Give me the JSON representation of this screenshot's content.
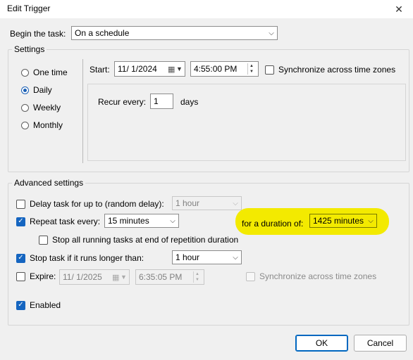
{
  "window": {
    "title": "Edit Trigger",
    "close_glyph": "✕"
  },
  "begin": {
    "label": "Begin the task:",
    "value": "On a schedule"
  },
  "settings": {
    "legend": "Settings",
    "radios": [
      {
        "label": "One time",
        "selected": false
      },
      {
        "label": "Daily",
        "selected": true
      },
      {
        "label": "Weekly",
        "selected": false
      },
      {
        "label": "Monthly",
        "selected": false
      }
    ],
    "start_label": "Start:",
    "start_date": "11/  1/2024",
    "start_time": "4:55:00 PM",
    "sync_label": "Synchronize across time zones",
    "recur_label": "Recur every:",
    "recur_value": "1",
    "recur_unit": "days"
  },
  "advanced": {
    "legend": "Advanced settings",
    "delay": {
      "label": "Delay task for up to (random delay):",
      "value": "1 hour",
      "checked": false
    },
    "repeat": {
      "label": "Repeat task every:",
      "value": "15 minutes",
      "checked": true
    },
    "duration": {
      "label": "for a duration of:",
      "value": "1425 minutes"
    },
    "stop_running": {
      "label": "Stop all running tasks at end of repetition duration",
      "checked": false
    },
    "stop_longer": {
      "label": "Stop task if it runs longer than:",
      "value": "1 hour",
      "checked": true
    },
    "expire": {
      "label": "Expire:",
      "date": "11/  1/2025",
      "time": "6:35:05 PM",
      "checked": false,
      "sync_label": "Synchronize across time zones"
    },
    "enabled": {
      "label": "Enabled",
      "checked": true
    }
  },
  "buttons": {
    "ok": "OK",
    "cancel": "Cancel"
  },
  "colors": {
    "highlight": "#f3ea00",
    "accent": "#1565c0"
  }
}
